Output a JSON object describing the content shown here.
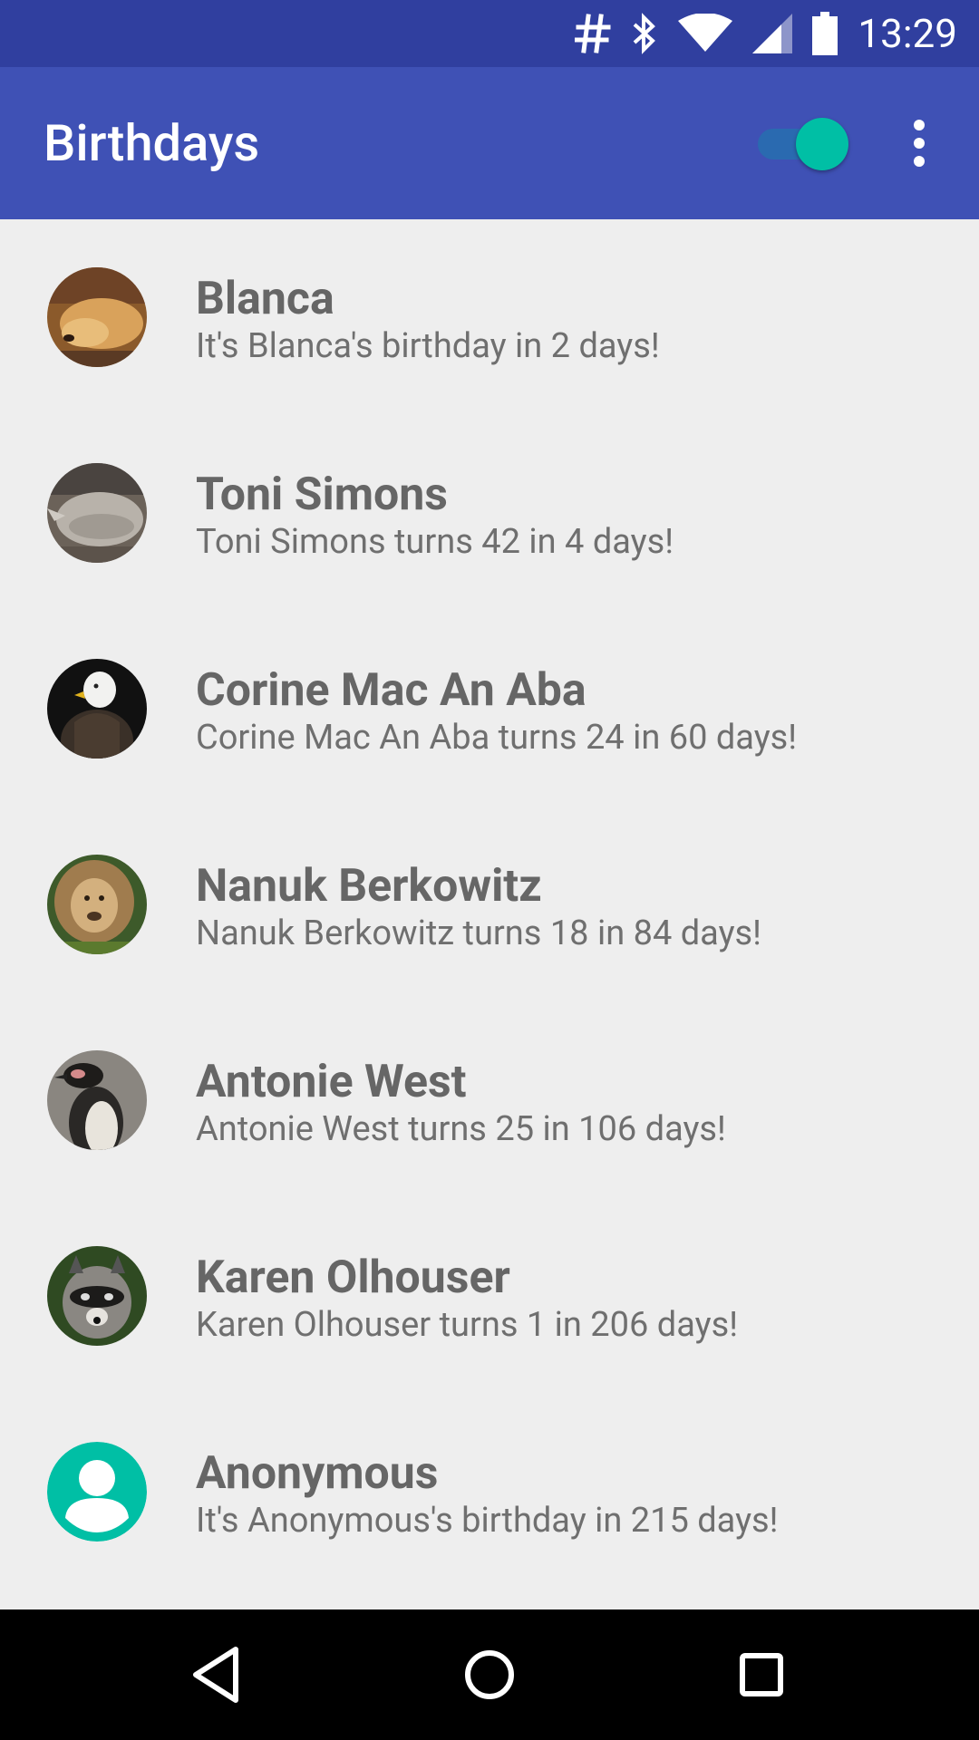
{
  "status_bar": {
    "time": "13:29",
    "icons": [
      "hash-icon",
      "bluetooth-icon",
      "wifi-icon",
      "cell-signal-icon",
      "battery-icon"
    ]
  },
  "app_bar": {
    "title": "Birthdays",
    "toggle_on": true,
    "menu_icon": "more-vert-icon"
  },
  "colors": {
    "status_bar": "#303f9f",
    "app_bar": "#3f51b5",
    "accent": "#00bfa5",
    "background": "#eeeeee",
    "text": "#666666"
  },
  "birthdays": [
    {
      "name": "Blanca",
      "message": "It's Blanca's birthday in 2 days!",
      "avatar": "dog-photo"
    },
    {
      "name": "Toni Simons",
      "message": "Toni Simons turns 42 in 4 days!",
      "avatar": "rhino-photo"
    },
    {
      "name": "Corine Mac An Aba",
      "message": "Corine Mac An Aba turns 24 in 60 days!",
      "avatar": "eagle-photo"
    },
    {
      "name": "Nanuk Berkowitz",
      "message": "Nanuk Berkowitz turns 18 in 84 days!",
      "avatar": "lion-photo"
    },
    {
      "name": "Antonie West",
      "message": "Antonie West turns 25 in 106 days!",
      "avatar": "penguin-photo"
    },
    {
      "name": "Karen Olhouser",
      "message": "Karen Olhouser turns 1 in 206 days!",
      "avatar": "raccoon-photo"
    },
    {
      "name": "Anonymous",
      "message": "It's Anonymous's birthday in 215 days!",
      "avatar": "default-person-icon"
    }
  ],
  "nav_bar": {
    "buttons": [
      "back-icon",
      "home-icon",
      "recents-icon"
    ]
  }
}
